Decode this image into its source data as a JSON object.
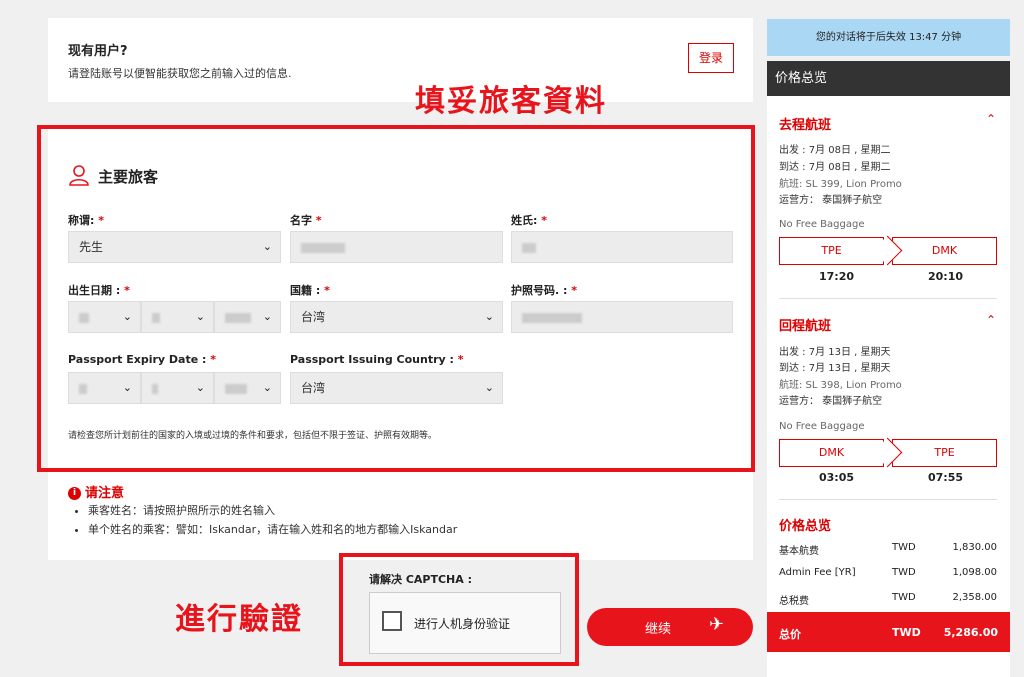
{
  "existing_user": {
    "title": "现有用户?",
    "subtitle": "请登陆账号以便智能获取您之前输入过的信息.",
    "login_label": "登录"
  },
  "annotations": {
    "fill_info": "填妥旅客資料",
    "verify": "進行驗證"
  },
  "traveler": {
    "section_title": "主要旅客",
    "title_label": "称谓:",
    "title_value": "先生",
    "first_name_label": "名字",
    "last_name_label": "姓氏:",
    "dob_label": "出生日期 :",
    "nationality_label": "国籍 :",
    "nationality_value": "台湾",
    "passport_no_label": "护照号码. :",
    "expiry_label": "Passport Expiry Date :",
    "issuing_country_label": "Passport Issuing Country :",
    "issuing_country_value": "台湾",
    "required_mark": "*",
    "note": "请检查您所计划前往的国家的入境或过境的条件和要求，包括但不限于签证、护照有效期等。"
  },
  "notice": {
    "title": "请注意",
    "items": [
      "乘客姓名：请按照护照所示的姓名输入",
      "单个姓名的乘客：譬如：Iskandar，请在输入姓和名的地方都输入Iskandar"
    ]
  },
  "captcha": {
    "label": "请解决 CAPTCHA :",
    "checkbox_text": "进行人机身份验证"
  },
  "continue_label": "继续",
  "sidebar": {
    "timer": "您的对话将于后失效 13:47 分钟",
    "header": "价格总览",
    "outbound": {
      "title": "去程航班",
      "depart": "出发 : 7月 08日 , 星期二",
      "arrive": "到达 : 7月 08日 , 星期二",
      "flight": "航班: SL 399, Lion Promo",
      "operator": "运营方： 泰国狮子航空",
      "baggage": "No Free Baggage",
      "from": "TPE",
      "to": "DMK",
      "dep_time": "17:20",
      "arr_time": "20:10"
    },
    "inbound": {
      "title": "回程航班",
      "depart": "出发 : 7月 13日 , 星期天",
      "arrive": "到达 : 7月 13日 , 星期天",
      "flight": "航班: SL 398, Lion Promo",
      "operator": "运营方： 泰国狮子航空",
      "baggage": "No Free Baggage",
      "from": "DMK",
      "to": "TPE",
      "dep_time": "03:05",
      "arr_time": "07:55"
    },
    "price": {
      "title": "价格总览",
      "rows": [
        {
          "name": "基本航费",
          "currency": "TWD",
          "value": "1,830.00"
        },
        {
          "name": "Admin Fee [YR]",
          "currency": "TWD",
          "value": "1,098.00"
        },
        {
          "name": "总税费",
          "currency": "TWD",
          "value": "2,358.00"
        }
      ],
      "total_label": "总价",
      "total_currency": "TWD",
      "total_value": "5,286.00"
    }
  },
  "colors": {
    "accent": "#e8141c",
    "timer_bg": "#aad7f4",
    "header_bg": "#333333"
  }
}
